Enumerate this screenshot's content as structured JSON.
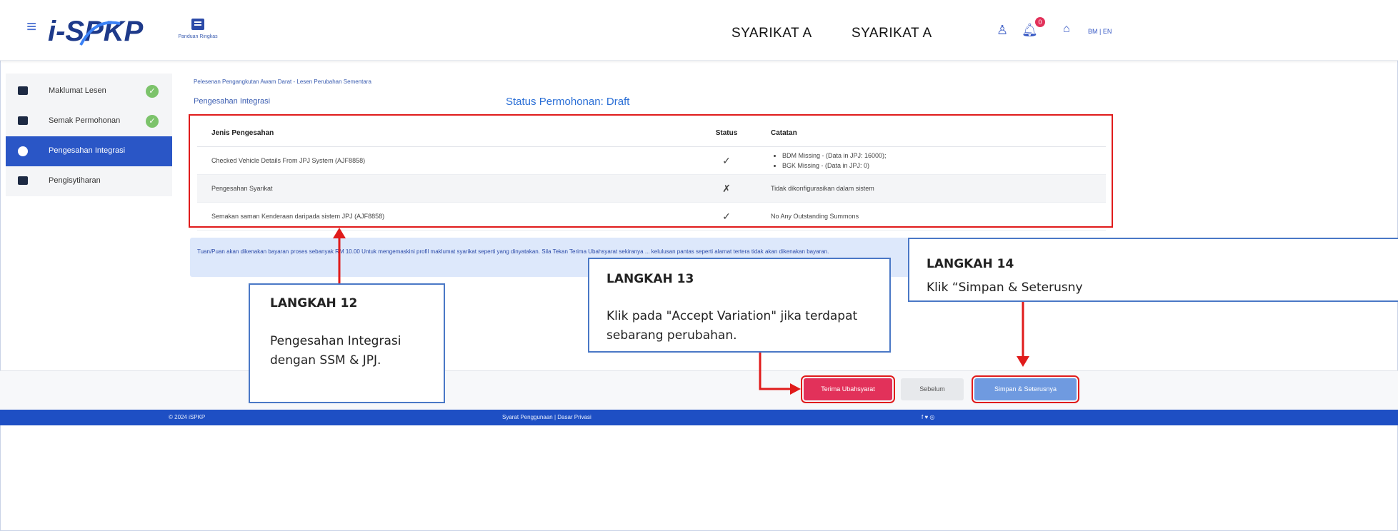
{
  "header": {
    "logo_text": "i-SPKP",
    "guide_label": "Panduan Ringkas",
    "user_name_1": "SYARIKAT A",
    "user_name_2": "SYARIKAT A",
    "notification_count": "0",
    "lang_switch": "BM | EN"
  },
  "sidebar": {
    "items": [
      {
        "label": "Maklumat Lesen",
        "icon": "folder-icon"
      },
      {
        "label": "Semak Permohonan",
        "icon": "comment-icon"
      },
      {
        "label": "Pengesahan Integrasi",
        "icon": "check-circle-icon"
      },
      {
        "label": "Pengisytiharan",
        "icon": "clipboard-icon"
      }
    ]
  },
  "main": {
    "breadcrumb": "Pelesenan Pengangkutan Awam Darat - Lesen Perubahan Sementara",
    "page_title": "Pengesahan Integrasi",
    "status_label": "Status Permohonan: Draft",
    "table": {
      "headers": [
        "Jenis Pengesahan",
        "Status",
        "Catatan"
      ],
      "rows": [
        {
          "jenis": "Checked Vehicle Details From JPJ System (AJF8858)",
          "status": "✓",
          "catatan": [
            "BDM Missing - (Data in JPJ: 16000);",
            "BGK Missing - (Data in JPJ: 0)"
          ]
        },
        {
          "jenis": "Pengesahan Syarikat",
          "status": "✗",
          "catatan": "Tidak dikonfigurasikan dalam sistem"
        },
        {
          "jenis": "Semakan saman Kenderaan daripada sistem JPJ (AJF8858)",
          "status": "✓",
          "catatan": "No Any Outstanding Summons"
        }
      ]
    },
    "notice": "Tuan/Puan akan dikenakan bayaran proses sebanyak RM 10.00 Untuk mengemaskini profil maklumat syarikat seperti yang dinyatakan. Sila Tekan Terima Ubahsyarat sekiranya ... kelulusan pantas seperti alamat tertera tidak akan dikenakan bayaran."
  },
  "callouts": {
    "step12": {
      "title": "LANGKAH 12",
      "body": "Pengesahan Integrasi dengan SSM & JPJ."
    },
    "step13": {
      "title": "LANGKAH 13",
      "body": "Klik pada \"Accept Variation\" jika terdapat sebarang perubahan."
    },
    "step14": {
      "title": "LANGKAH 14",
      "body": "Klik “Simpan & Seterusny"
    }
  },
  "actions": {
    "accept": "Terima Ubahsyarat",
    "previous": "Sebelum",
    "next": "Simpan & Seterusnya"
  },
  "footer": {
    "copyright": "© 2024 iSPKP",
    "links": "Syarat Penggunaan | Dasar Privasi",
    "social": "f ♥ ◎"
  },
  "colors": {
    "primary": "#2a56c6",
    "accept": "#e2315a",
    "annotation_red": "#e01b1b",
    "success": "#46a84a"
  }
}
